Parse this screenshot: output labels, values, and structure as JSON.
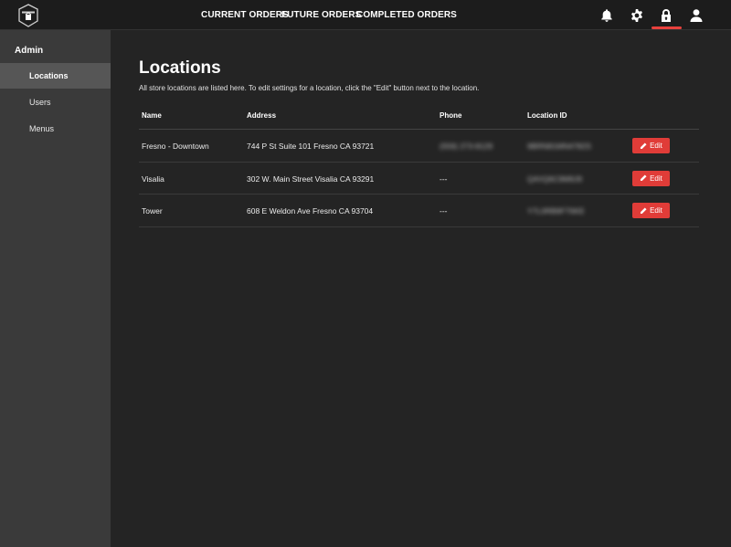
{
  "nav": {
    "items": [
      "CURRENT ORDERS",
      "FUTURE ORDERS",
      "COMPLETED ORDERS"
    ],
    "icons": [
      "bell-icon",
      "gear-icon",
      "lock-icon",
      "user-icon"
    ],
    "active_icon": "lock-icon",
    "accent_color": "#e8413d"
  },
  "sidebar": {
    "heading": "Admin",
    "items": [
      {
        "label": "Locations",
        "active": true
      },
      {
        "label": "Users",
        "active": false
      },
      {
        "label": "Menus",
        "active": false
      }
    ]
  },
  "page": {
    "title": "Locations",
    "description": "All store locations are listed here. To edit settings for a location, click the \"Edit\" button next to the location."
  },
  "table": {
    "columns": [
      "Name",
      "Address",
      "Phone",
      "Location ID"
    ],
    "rows": [
      {
        "name": "Fresno - Downtown",
        "address": "744 P St Suite 101 Fresno CA 93721",
        "phone": "(559) 273-8129",
        "location_id": "9BRN81MN4782S",
        "edit_label": "Edit"
      },
      {
        "name": "Visalia",
        "address": "302 W. Main Street Visalia CA 93291",
        "phone": "---",
        "location_id": "Q4VQ6C9M9J9",
        "edit_label": "Edit"
      },
      {
        "name": "Tower",
        "address": "608 E Weldon Ave Fresno CA 93704",
        "phone": "---",
        "location_id": "Y7L0RB9FT6KE",
        "edit_label": "Edit"
      }
    ]
  }
}
